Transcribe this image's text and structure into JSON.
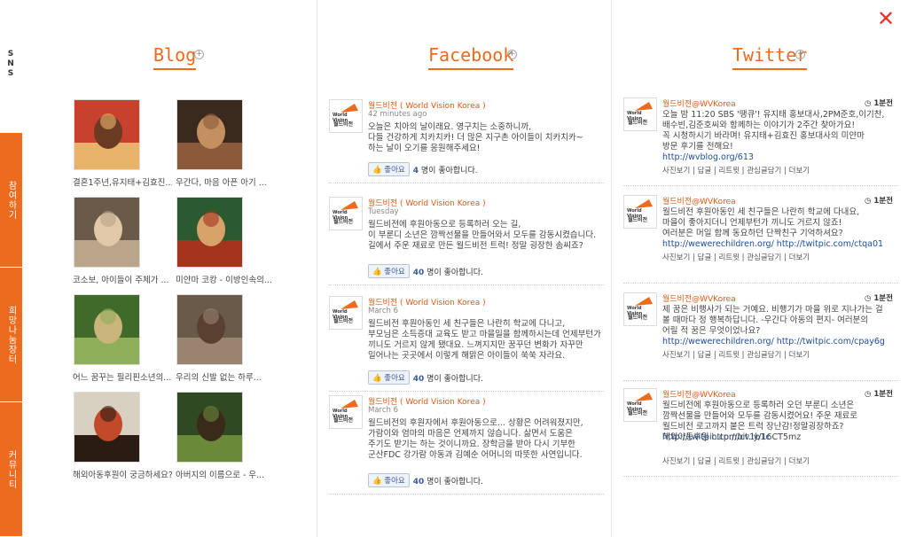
{
  "sidebar": {
    "sns": "SNS",
    "tabs": [
      "참여하기",
      "희망나눔장터",
      "커뮤니티"
    ]
  },
  "columns": {
    "blog": "Blog",
    "facebook": "Facebook",
    "twitter": "Twitter",
    "plus": "+"
  },
  "close": "✕",
  "blog": {
    "items": [
      {
        "caption": "결혼1주년,유지태+김효진..."
      },
      {
        "caption": "우간다, 마음 아픈 아기 ..."
      },
      {
        "caption": "코소보, 아이들이 주체가 ..."
      },
      {
        "caption": "미얀마 코캉 - 이방인속의..."
      },
      {
        "caption": "어느 꿈꾸는 필리핀소년의..."
      },
      {
        "caption": "우리의 신발 없는 하루..."
      },
      {
        "caption": "해외아동후원이 궁금하세요?"
      },
      {
        "caption": "아버지의 이름으로 - 우..."
      }
    ]
  },
  "facebook": {
    "like_label": "좋아요",
    "like_suffix": "명이 좋아합니다.",
    "posts": [
      {
        "name": "월드비전 ( World Vision Korea )",
        "time": "42 minutes ago",
        "text": "오늘은 치아의 날이래요. 영구치는 소중하니까,\n다들 건강하게 치카치카! 더 많은 지구촌 아이들이 치카치카~\n하는 날이 오기를 응원해주세요!",
        "likes": "4"
      },
      {
        "name": "월드비전 ( World Vision Korea )",
        "time": "Tuesday",
        "text": "월드비전에 후원아동으로 등록하러 오는 길,\n이 부룬디 소년은 깜짝선물을 만들어와서 모두를 감동시켰습니다.\n길에서 주운 재료로 만든 월드비전 트럭! 정말 굉장한 솜씨죠?",
        "likes": "40"
      },
      {
        "name": "월드비전 ( World Vision Korea )",
        "time": "March 6",
        "text": "월드비전 후원아동인 세 친구들은 나란히 학교에 다니고,\n부모님은 소득증대 교육도 받고 마을일을 함께하시는데 언제부턴가\n끼니도 거르지 않게 됐대요. 느껴지지만 꿈꾸던 변화가 자꾸만\n일어나는 곳곳에서 이렇게 해맑은 아이들이 쑥쑥 자라요.",
        "likes": "40"
      },
      {
        "name": "월드비전 ( World Vision Korea )",
        "time": "March 6",
        "text": "월드비전의 후원자에서 후원아동으로... 상황은 어려워졌지만,\n가람이와 엄마의 마음은 언제까지 않습니다. 삶면서 도움은\n주기도 받기는 하는 것이니까요. 장학금을 받아 다시 기부한\n군산FDC 강가람 아동과 김예순 어머니의 따뜻한 사연입니다.",
        "likes": "40"
      }
    ]
  },
  "twitter": {
    "actions": [
      "사진보기",
      "답글",
      "리트윗",
      "관심글담기",
      "더보기"
    ],
    "posts": [
      {
        "name": "월드비전@WVKorea",
        "time": "1분전",
        "text": "오늘 밤 11:20 SBS '땡큐'! 유지태 홍보대사,2PM준호,이기찬,\n배수빈,김준호씨와 함께하는 이야기가 2주간 찾아가요!\n꼭 시청하시기 바라며! 유지태+김효진 홍보대사의 미얀마\n방문 후기를 전해요!",
        "link": "http://wvblog.org/613"
      },
      {
        "name": "월드비전@WVKorea",
        "time": "1분전",
        "text": "월드비전 후원아동인 세 친구들은 나란히 학교에 다내요,\n마을이 좋아지더니 언제부턴가 끼니도 거르지 않죠!\n여러분은 머일 함께 동요하던 단짝친구 기억하셔요?",
        "link": "http://wewerechildren.org/ http://twitpic.com/ctqa01"
      },
      {
        "name": "월드비전@WVKorea",
        "time": "1분전",
        "text": "제 꿈은 비행사가 되는 거예요. 비행기가 마을 위로 지나가는 걸\n볼 때마다 정 행복하답니다. -우간다 아동의 편지- 여러분의\n어릴 적 꿈은 무엇이었나요?",
        "link": "http://wewerechildren.org/ http://twitpic.com/cpay6g"
      },
      {
        "name": "월드비전@WVKorea",
        "time": "1분전",
        "text": "월드비전에 후원아동으로 등록하러 오던 부룬디 소년은\n깜짝선물을 만들어와 모두를 감동시켰어요! 주운 재료로\n월드비전 로고까지 붙은 트럭 장난감!정말굉장하죠?",
        "link": "http://twitpic.com/cv1b1c",
        "extra": "해외아동후원 http://bit.ly/16CT5mz"
      }
    ]
  },
  "colors": {
    "accent": "#ed6b1f",
    "link": "#1a4ea0",
    "facebook": "#3b5998"
  }
}
